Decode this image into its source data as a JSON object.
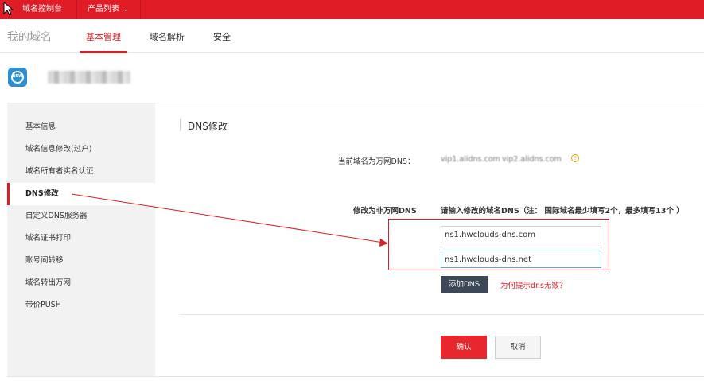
{
  "topbar": {
    "console_label": "域名控制台",
    "product_list_label": "产品列表",
    "chevron_glyph": "⌄"
  },
  "nav": {
    "brand": "我的域名",
    "tabs": [
      {
        "label": "基本管理",
        "active": true
      },
      {
        "label": "域名解析",
        "active": false
      },
      {
        "label": "安全",
        "active": false
      }
    ]
  },
  "domain": {
    "logo_text": "NEW",
    "name": "■■■■■.com"
  },
  "sidebar": {
    "items": [
      {
        "label": "基本信息",
        "active": false
      },
      {
        "label": "域名信息修改(过户)",
        "active": false
      },
      {
        "label": "域名所有者实名认证",
        "active": false
      },
      {
        "label": "DNS修改",
        "active": true
      },
      {
        "label": "自定义DNS服务器",
        "active": false
      },
      {
        "label": "域名证书打印",
        "active": false
      },
      {
        "label": "账号间转移",
        "active": false
      },
      {
        "label": "域名转出万网",
        "active": false
      },
      {
        "label": "带价PUSH",
        "active": false
      }
    ]
  },
  "main": {
    "title": "DNS修改",
    "current_dns_label": "当前域名为万网DNS：",
    "current_dns": [
      "vip1.alidns.com",
      "vip2.alidns.com"
    ],
    "warn_glyph": "!",
    "modify_label": "修改为非万网DNS",
    "modify_hint": "请输入修改的域名DNS（注： 国际域名最少填写2个，最多填写13个 ）",
    "dns_inputs": [
      "ns1.hwclouds-dns.com",
      "ns1.hwclouds-dns.net"
    ],
    "add_dns_label": "添加DNS",
    "why_link": "为何提示dns无效？",
    "confirm_label": "确认",
    "cancel_label": "取消"
  },
  "colors": {
    "brand_red": "#e01c26",
    "dark_button": "#3c4857",
    "sidebar_bg": "#f2f2f2",
    "annotation": "#e01c26"
  }
}
